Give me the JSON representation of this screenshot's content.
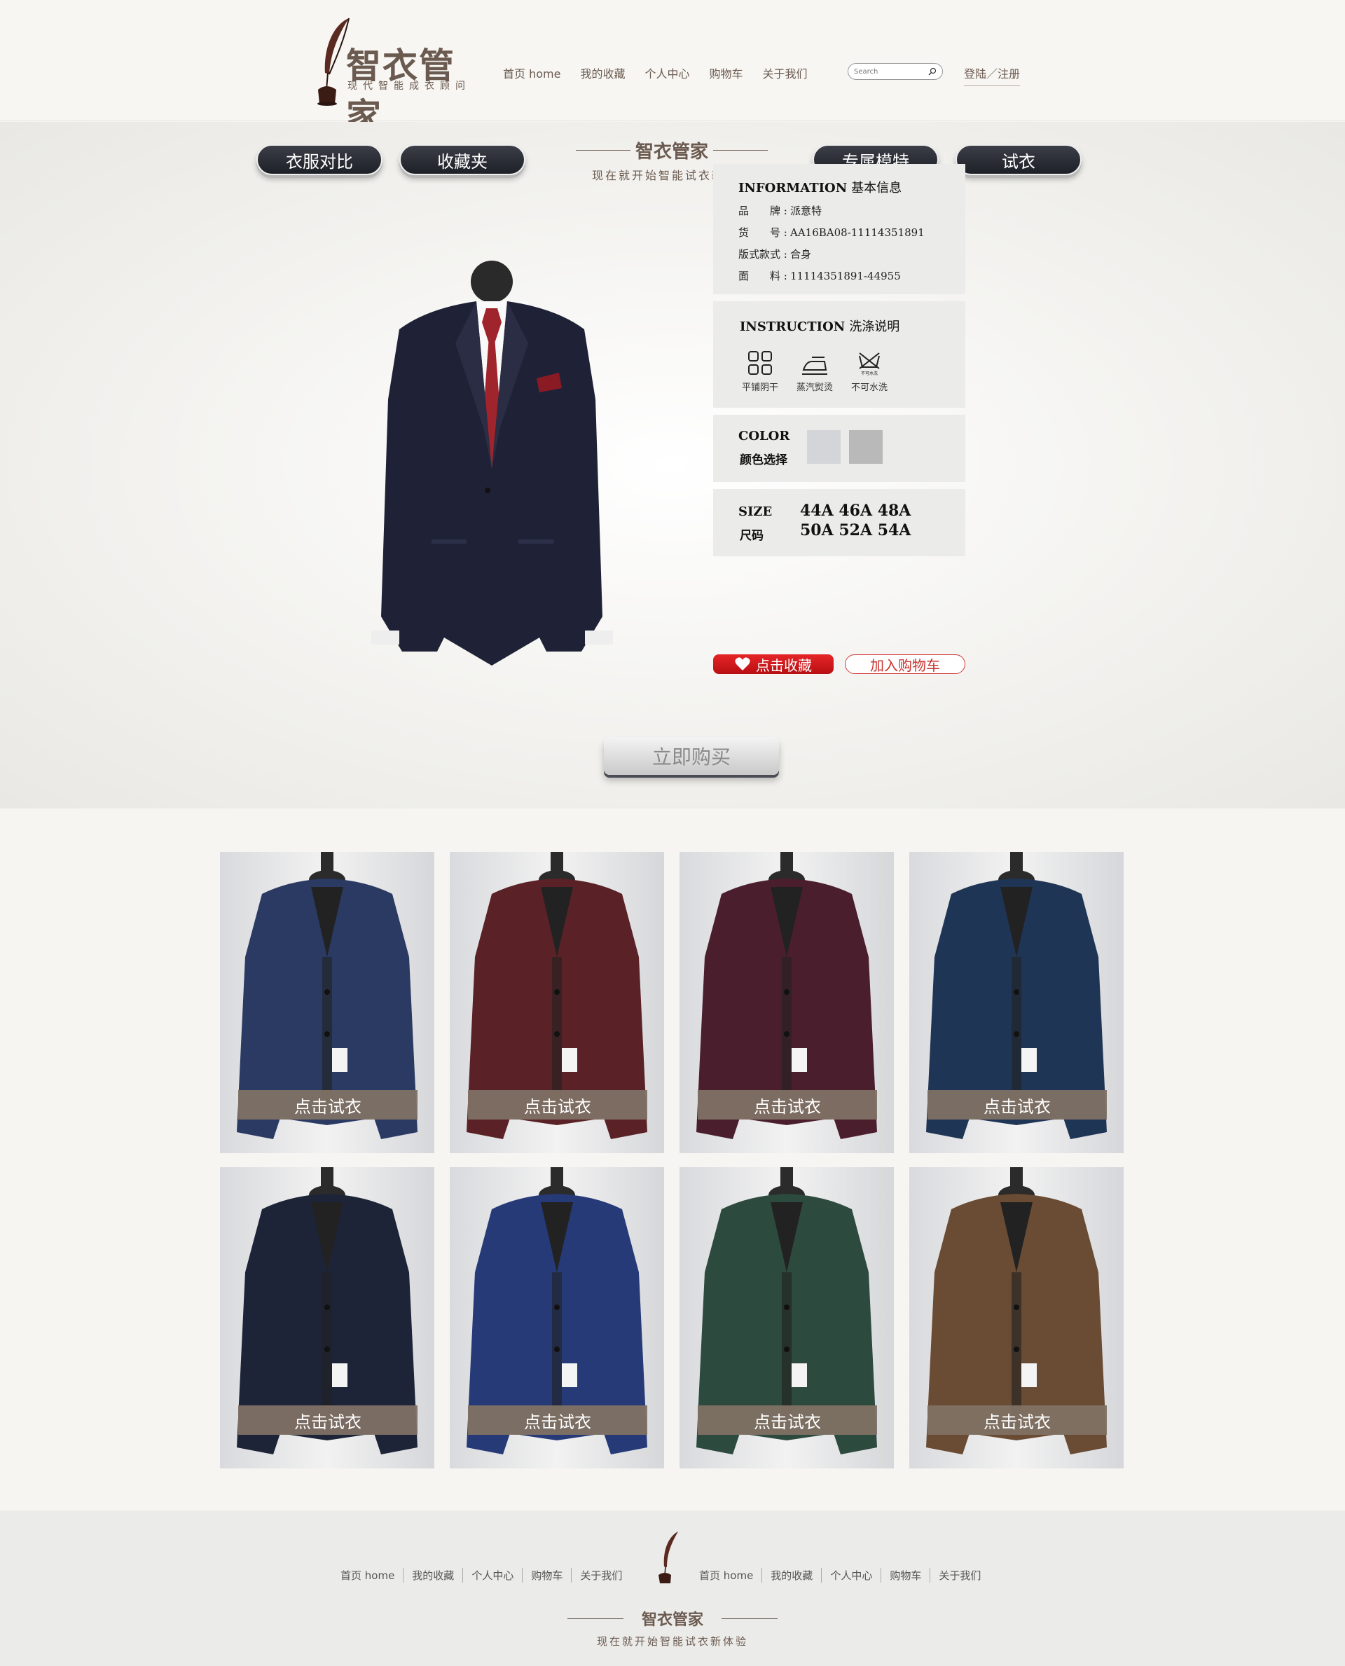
{
  "header": {
    "brand": "智衣管家",
    "tagline": "现代智能成衣顾问",
    "nav": [
      "首页 home",
      "我的收藏",
      "个人中心",
      "购物车",
      "关于我们"
    ],
    "search_placeholder": "Search",
    "login": "登陆／注册"
  },
  "hero": {
    "tabs": [
      "衣服对比",
      "收藏夹",
      "专属模特",
      "试衣"
    ],
    "brand": "智衣管家",
    "slogan": "现在就开始智能试衣新体验"
  },
  "info": {
    "title": "INFORMATION",
    "title_zh": "基本信息",
    "rows": [
      {
        "k": "品　　牌 :",
        "v": "派意特"
      },
      {
        "k": "货　　号 :",
        "v": "AA16BA08-11114351891"
      },
      {
        "k": "版式款式 :",
        "v": "合身"
      },
      {
        "k": "面　　料 :",
        "v": "11114351891-44955"
      }
    ]
  },
  "instruction": {
    "title": "INSTRUCTION",
    "title_zh": "洗涤说明",
    "items": [
      {
        "icon": "flat-dry-icon",
        "label": "平铺阴干"
      },
      {
        "icon": "steam-iron-icon",
        "label": "蒸汽熨烫"
      },
      {
        "icon": "no-wash-icon",
        "label": "不可水洗",
        "mark": "不可水洗"
      }
    ]
  },
  "color": {
    "title": "COLOR",
    "title_zh": "颜色选择",
    "swatches": [
      "#d4d5d9",
      "#b9b9b9"
    ]
  },
  "size": {
    "title": "SIZE",
    "title_zh": "尺码",
    "row1": "44A 46A 48A",
    "row2": "50A 52A 54A"
  },
  "actions": {
    "favorite": "点击收藏",
    "cart": "加入购物车",
    "buy": "立即购买"
  },
  "products": [
    {
      "label": "点击试衣",
      "color": "#2a3a63"
    },
    {
      "label": "点击试衣",
      "color": "#5a2227"
    },
    {
      "label": "点击试衣",
      "color": "#4b1e2e"
    },
    {
      "label": "点击试衣",
      "color": "#1f3555"
    },
    {
      "label": "点击试衣",
      "color": "#1d2438"
    },
    {
      "label": "点击试衣",
      "color": "#263a78"
    },
    {
      "label": "点击试衣",
      "color": "#2d4a3e"
    },
    {
      "label": "点击试衣",
      "color": "#6a4b33"
    }
  ],
  "footer": {
    "nav_left": [
      "首页 home",
      "我的收藏",
      "个人中心",
      "购物车",
      "关于我们"
    ],
    "nav_right": [
      "首页 home",
      "我的收藏",
      "个人中心",
      "购物车",
      "关于我们"
    ],
    "brand": "智衣管家",
    "slogan": "现在就开始智能试衣新体验"
  }
}
